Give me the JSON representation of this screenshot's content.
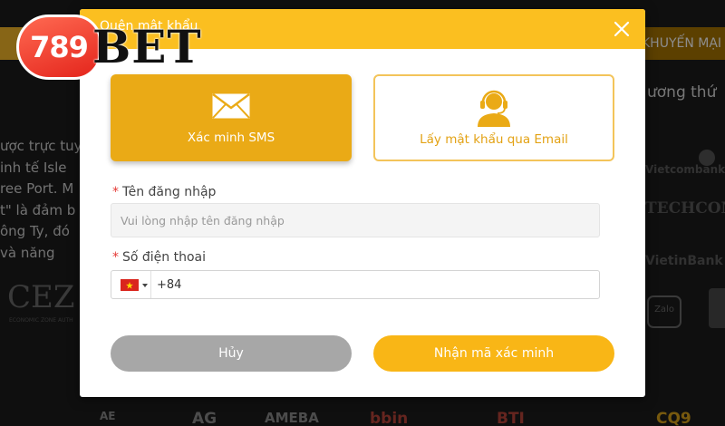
{
  "brand": {
    "number": "789",
    "word": "BET"
  },
  "background": {
    "nav_item": "KHUYẾN MẠI",
    "right_heading": "ương thứ",
    "left_text_lines": [
      "ược trực tuy",
      "inh tế Isle",
      "ree Port. M",
      "t\" là đảm b",
      "ông Ty, đó",
      "và năng"
    ],
    "bank_logos": [
      "Vietcombank",
      "TECHCOM",
      "VietinBank"
    ],
    "cez": "CEZ",
    "cez_sub": "ECONOMIC ZONE AUTH",
    "zalo": "Zalo",
    "footer_logos": [
      "AE",
      "AG",
      "AMEBA",
      "bbin",
      "BTI",
      "CQ9"
    ]
  },
  "modal": {
    "title": "Quên mật khẩu",
    "methods": {
      "sms_label": "Xác minh SMS",
      "email_label": "Lấy mật khẩu qua Email"
    },
    "username": {
      "label": "Tên đăng nhập",
      "required_mark": "*",
      "placeholder": "Vui lòng nhập tên đăng nhập"
    },
    "phone": {
      "label": "Số điện thoai",
      "required_mark": "*",
      "value": "+84",
      "country": "VN"
    },
    "buttons": {
      "cancel": "Hủy",
      "submit": "Nhận mã xác minh"
    }
  },
  "colors": {
    "accent": "#fbbf20",
    "sms_card": "#eaaa16",
    "email_label": "#e3a214",
    "cancel": "#a7a7a7",
    "submit": "#f9b616",
    "required": "#e53935"
  }
}
